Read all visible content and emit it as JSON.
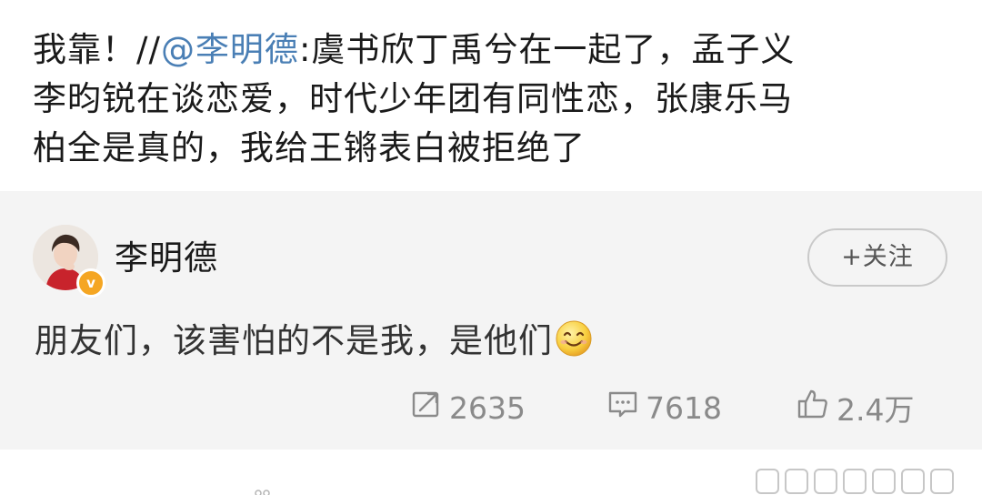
{
  "repost": {
    "prefix": "我靠！//",
    "mention": "@李明德",
    "line1_rest": ":虞书欣丁禹兮在一起了，孟子义",
    "line2": "李昀锐在谈恋爱，时代少年团有同性恋，张康乐马",
    "line3": "柏全是真的，我给王锵表白被拒绝了"
  },
  "original_post": {
    "author": "李明德",
    "verified_badge": "v",
    "follow_label": "+关注",
    "text": "朋友们，该害怕的不是我，是他们",
    "emoji_icon": "smiling-face-icon",
    "stats": {
      "reposts": "2635",
      "comments": "7618",
      "likes": "2.4万"
    }
  },
  "colors": {
    "mention": "#4a7fb5",
    "card_bg": "#f4f4f4",
    "verified": "#f5a623",
    "stat_text": "#8a8a8a"
  }
}
